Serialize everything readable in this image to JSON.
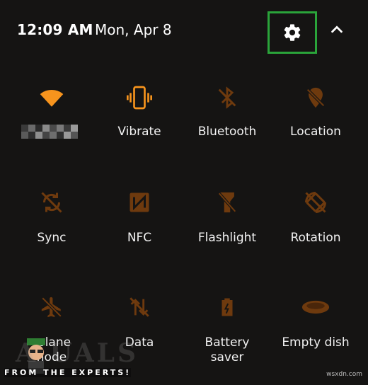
{
  "status": {
    "time": "12:09 AM",
    "date": "Mon, Apr 8"
  },
  "icons": {
    "settings": "gear-icon",
    "collapse": "chevron-up-icon"
  },
  "colors": {
    "active": "#f7941d",
    "inactive": "#6e3a0e",
    "highlight": "#2aa43a",
    "background": "#151413"
  },
  "tiles": [
    {
      "label": "",
      "icon": "wifi-icon",
      "active": true
    },
    {
      "label": "Vibrate",
      "icon": "vibrate-icon",
      "active": true
    },
    {
      "label": "Bluetooth",
      "icon": "bluetooth-icon",
      "active": false
    },
    {
      "label": "Location",
      "icon": "location-icon",
      "active": false
    },
    {
      "label": "Sync",
      "icon": "sync-icon",
      "active": false
    },
    {
      "label": "NFC",
      "icon": "nfc-icon",
      "active": false
    },
    {
      "label": "Flashlight",
      "icon": "flashlight-icon",
      "active": false
    },
    {
      "label": "Rotation",
      "icon": "rotation-icon",
      "active": false
    },
    {
      "label": "rplane\nnode",
      "icon": "airplane-icon",
      "active": false
    },
    {
      "label": "Data",
      "icon": "data-icon",
      "active": false
    },
    {
      "label": "Battery\nsaver",
      "icon": "battery-icon",
      "active": false
    },
    {
      "label": "Empty dish",
      "icon": "dish-icon",
      "active": false
    }
  ],
  "watermark": {
    "text": "A  UALS",
    "subtitle": "FROM THE EXPERTS!",
    "credit": "wsxdn.com"
  }
}
